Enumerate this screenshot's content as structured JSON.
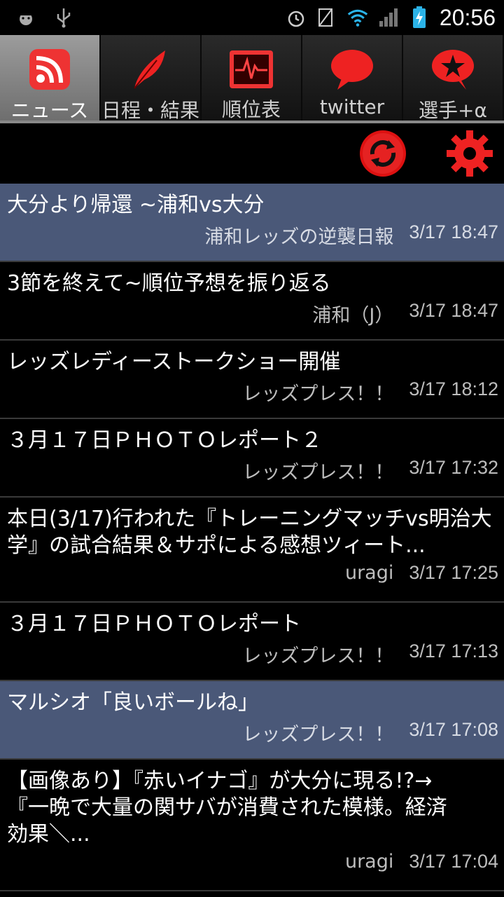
{
  "status_bar": {
    "time": "20:56",
    "icons": [
      "android-debug-icon",
      "usb-icon",
      "alarm-icon",
      "no-signal-icon",
      "wifi-icon",
      "cell-signal-icon",
      "battery-charging-icon"
    ]
  },
  "tabs": [
    {
      "label": "ニュース",
      "icon": "rss-icon",
      "active": true
    },
    {
      "label": "日程・結果",
      "icon": "feather-icon",
      "active": false
    },
    {
      "label": "順位表",
      "icon": "chart-monitor-icon",
      "active": false
    },
    {
      "label": "twitter",
      "icon": "speech-bubble-icon",
      "active": false
    },
    {
      "label": "選手+α",
      "icon": "star-bubble-icon",
      "active": false
    }
  ],
  "news": [
    {
      "title": "大分より帰還 ~浦和vs大分",
      "source": "浦和レッズの逆襲日報",
      "time": "3/17 18:47"
    },
    {
      "title": "3節を終えて~順位予想を振り返る",
      "source": "浦和（J）",
      "time": "3/17 18:47"
    },
    {
      "title": "レッズレディーストークショー開催",
      "source": "レッズプレス！！",
      "time": "3/17 18:12"
    },
    {
      "title": "３月１７日ＰＨＯＴＯレポート２",
      "source": "レッズプレス！！",
      "time": "3/17 17:32"
    },
    {
      "title": "本日(3/17)行われた『トレーニングマッチvs明治大学』の試合結果＆サポによる感想ツィート...",
      "source": "uragi",
      "time": "3/17 17:25"
    },
    {
      "title": "３月１７日ＰＨＯＴＯレポート",
      "source": "レッズプレス！！",
      "time": "3/17 17:13"
    },
    {
      "title": "マルシオ「良いボールね」",
      "source": "レッズプレス！！",
      "time": "3/17 17:08"
    },
    {
      "title": "【画像あり】『赤いイナゴ』が大分に現る!?→『一晩で大量の関サバが消費された模様。経済効果＼...",
      "source": "uragi",
      "time": "3/17 17:04"
    }
  ]
}
